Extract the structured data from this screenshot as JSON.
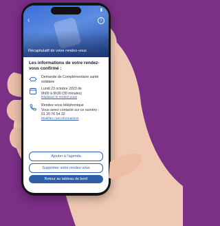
{
  "status_bar": {
    "time": "",
    "battery_label": ""
  },
  "header": {
    "title": "Récapitulatif de votre rendez-vous"
  },
  "summary": {
    "heading": "Les informations de votre rendez-vous confirmé :",
    "items": [
      {
        "icon": "handshake-icon",
        "lines": [
          "Demande de Complémentaire santé",
          "solidaire"
        ]
      },
      {
        "icon": "calendar-icon",
        "lines": [
          "Lundi 23 octobre 2023 de",
          "9h00 à 9h30 (30 minutes)"
        ],
        "link": "Déplacer le rendez-vous"
      },
      {
        "icon": "phone-icon",
        "lines": [
          "Rendez-vous téléphonique",
          "Vous serez contacté sur ce numéro :",
          "01 20 76 54 32"
        ],
        "link": "Modifiez nos informations"
      }
    ]
  },
  "actions": {
    "add_agenda": "Ajouter à l'agenda",
    "delete_appointment": "Supprimer votre rendez-vous",
    "back_dashboard": "Retour au tableau de bord"
  },
  "colors": {
    "brand": "#2e5ea8",
    "background": "#7b2f86"
  }
}
